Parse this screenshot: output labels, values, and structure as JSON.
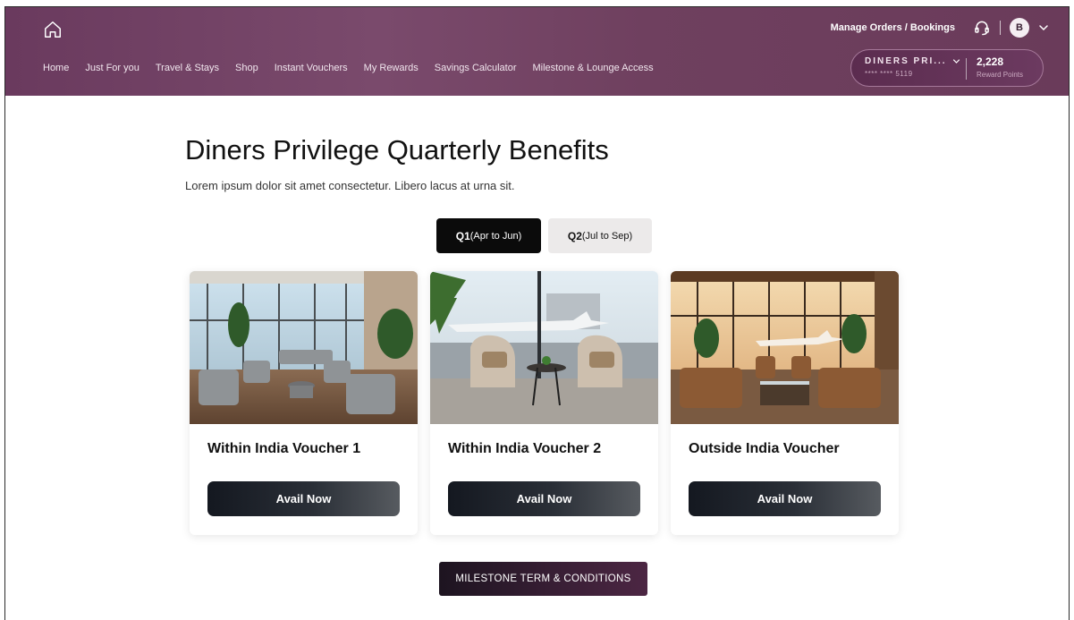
{
  "header": {
    "nav": [
      "Home",
      "Just For you",
      "Travel & Stays",
      "Shop",
      "Instant Vouchers",
      "My Rewards",
      "Savings Calculator",
      "Milestone & Lounge Access"
    ],
    "manage_link": "Manage Orders / Bookings",
    "avatar_initial": "B",
    "card": {
      "name": "DINERS PRI...",
      "number": "**** **** 5119",
      "points": "2,228",
      "points_label": "Reward Points"
    }
  },
  "main": {
    "title": "Diners Privilege Quarterly Benefits",
    "subtitle": "Lorem ipsum dolor sit amet consectetur. Libero lacus at urna sit.",
    "tabs": [
      {
        "quarter": "Q1",
        "range": "(Apr to Jun)",
        "active": true
      },
      {
        "quarter": "Q2",
        "range": "(Jul to Sep)",
        "active": false
      }
    ],
    "cards": [
      {
        "title": "Within India Voucher 1",
        "button": "Avail Now"
      },
      {
        "title": "Within India Voucher 2",
        "button": "Avail Now"
      },
      {
        "title": "Outside India Voucher",
        "button": "Avail Now"
      }
    ],
    "terms_button": "MILESTONE TERM & CONDITIONS"
  },
  "colors": {
    "header": "#6f405f",
    "tab_active": "#0b0b0b",
    "tab_inactive": "#eceaea",
    "button_dark": "#141820",
    "terms_button": "#3a1f36"
  }
}
